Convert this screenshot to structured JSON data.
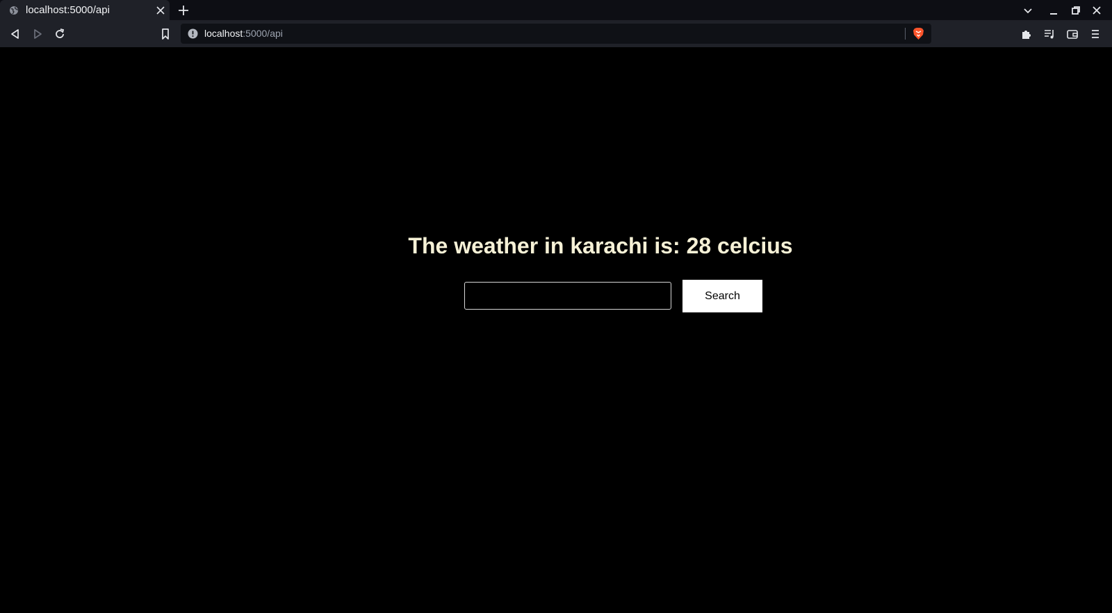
{
  "browser": {
    "tab": {
      "title": "localhost:5000/api"
    },
    "address_bar": {
      "host": "localhost",
      "path": ":5000/api"
    }
  },
  "icons": {
    "tab_favicon": "globe-icon",
    "tab_close": "close-icon",
    "new_tab": "plus-icon",
    "tab_list": "chevron-down-icon",
    "minimize": "minimize-icon",
    "restore": "restore-icon",
    "window_close": "close-icon",
    "back": "back-arrow-icon",
    "forward": "forward-arrow-icon",
    "reload": "reload-icon",
    "bookmark": "bookmark-icon",
    "site_info": "info-icon",
    "brave_shields": "brave-lion-icon",
    "extensions": "puzzle-icon",
    "media_playlist": "playlist-icon",
    "wallet": "wallet-icon",
    "menu": "hamburger-menu-icon"
  },
  "page": {
    "headline": "The weather in karachi is: 28 celcius",
    "search_input_value": "",
    "search_button_label": "Search"
  },
  "colors": {
    "page_background": "#000000",
    "headline_text": "#f6f1d6",
    "button_background": "#ffffff",
    "brave_accent": "#fb542b",
    "toolbar_background": "#1f2128"
  }
}
